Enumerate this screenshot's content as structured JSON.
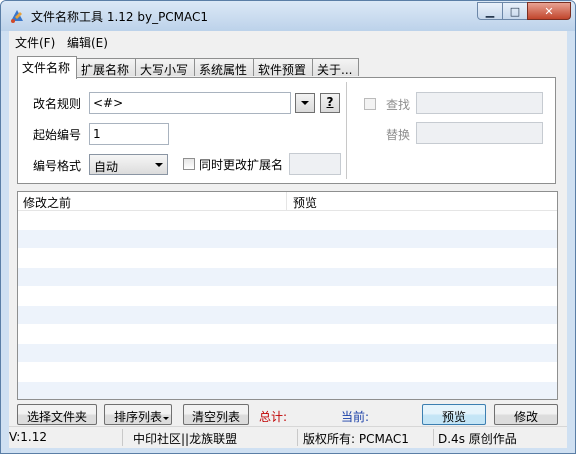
{
  "window": {
    "title": "文件名称工具 1.12  by_PCMAC1",
    "minimize_glyph": "▁",
    "maximize_glyph": "□",
    "close_glyph": "✕"
  },
  "menu": [
    "文件(F)",
    "编辑(E)"
  ],
  "tabs": [
    "文件名称",
    "扩展名称",
    "大写小写",
    "系统属性",
    "软件预置",
    "关于..."
  ],
  "rename_panel": {
    "rule_label": "改名规则",
    "rule_value": "<#>",
    "help_button": "?",
    "start_label": "起始编号",
    "start_value": "1",
    "format_label": "编号格式",
    "format_value": "自动",
    "change_ext_label": "同时更改扩展名",
    "find_label": "查找",
    "replace_label": "替换"
  },
  "list": {
    "columns": [
      "修改之前",
      "预览"
    ],
    "stripe_color": "#edf3fb"
  },
  "buttons": {
    "select_files": "选择文件夹",
    "sort_list": "排序列表",
    "clear_list": "清空列表",
    "preview": "预览",
    "modify": "修改"
  },
  "stats": {
    "total_label": "总计:",
    "total_color": "#c00000",
    "current_label": "当前:",
    "current_color": "#1a3fa8"
  },
  "status": {
    "version": "V:1.12",
    "community": "中印社区||龙族联盟",
    "copyright": "版权所有: PCMAC1",
    "author": "D.4s 原创作品"
  }
}
